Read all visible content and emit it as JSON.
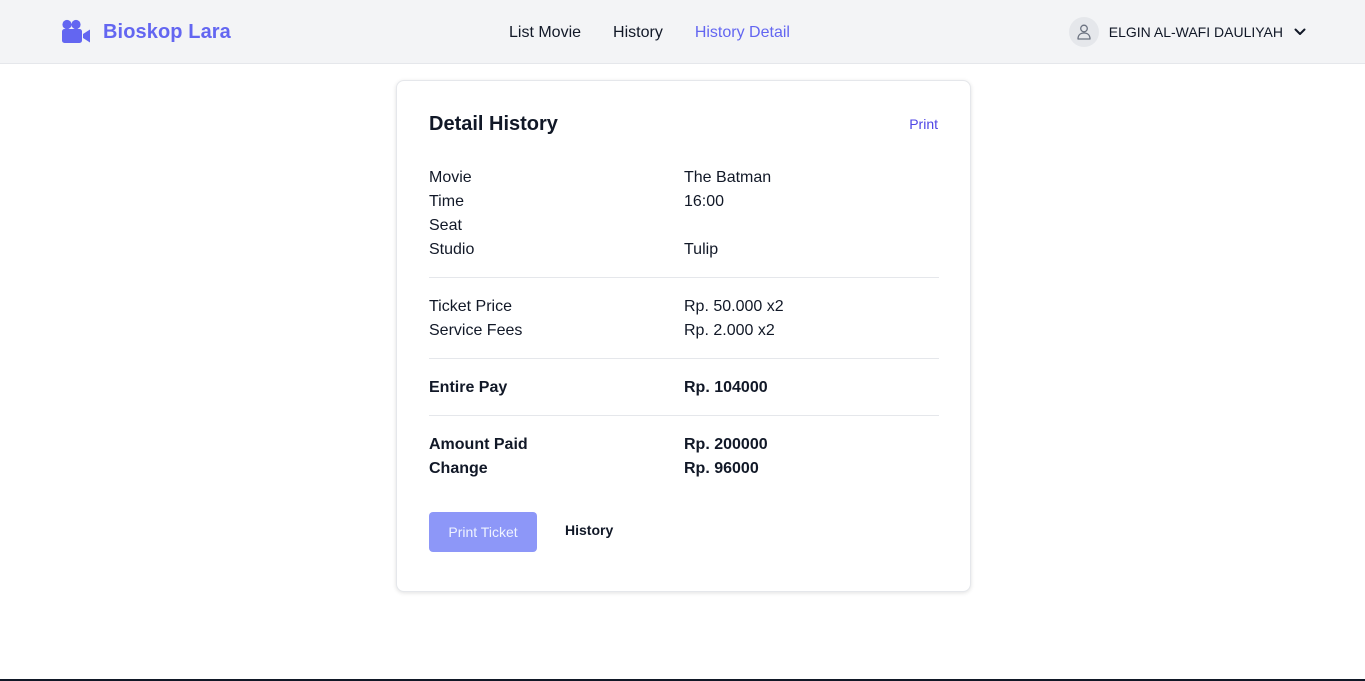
{
  "brand": {
    "name": "Bioskop Lara",
    "icon": "video-camera-icon",
    "color": "#6366f1"
  },
  "nav": {
    "links": [
      {
        "label": "List Movie",
        "active": false
      },
      {
        "label": "History",
        "active": false
      },
      {
        "label": "History Detail",
        "active": true
      }
    ]
  },
  "user": {
    "name": "ELGIN AL-WAFI DAULIYAH",
    "avatar_icon": "user-icon",
    "dropdown_icon": "chevron-down-icon"
  },
  "detail": {
    "title": "Detail History",
    "print_link": "Print",
    "info_rows": [
      {
        "label": "Movie",
        "value": "The Batman"
      },
      {
        "label": "Time",
        "value": "16:00"
      },
      {
        "label": "Seat",
        "value": ""
      },
      {
        "label": "Studio",
        "value": "Tulip"
      }
    ],
    "price_rows": [
      {
        "label": "Ticket Price",
        "value": "Rp. 50.000 x2"
      },
      {
        "label": "Service Fees",
        "value": "Rp. 2.000 x2"
      }
    ],
    "total": {
      "label": "Entire Pay",
      "value": "Rp. 104000"
    },
    "payment_rows": [
      {
        "label": "Amount Paid",
        "value": "Rp. 200000"
      },
      {
        "label": "Change",
        "value": "Rp. 96000"
      }
    ],
    "print_ticket_button": "Print Ticket",
    "history_button": "History"
  }
}
